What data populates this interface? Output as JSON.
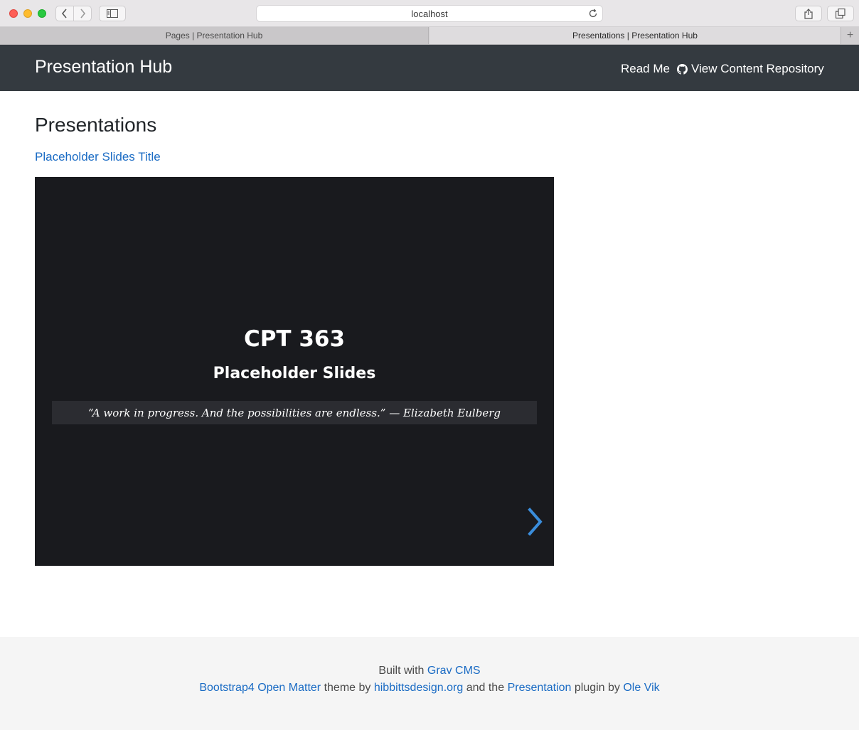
{
  "browser": {
    "url": "localhost",
    "tabs": [
      {
        "label": "Pages | Presentation Hub"
      },
      {
        "label": "Presentations | Presentation Hub"
      }
    ],
    "new_tab_label": "+"
  },
  "header": {
    "brand": "Presentation Hub",
    "nav": {
      "read_me": "Read Me",
      "view_repo": "View Content Repository"
    }
  },
  "main": {
    "title": "Presentations",
    "presentation_link": "Placeholder Slides Title",
    "slide": {
      "title": "CPT 363",
      "subtitle": "Placeholder Slides",
      "quote": "“A work in progress. And the possibilities are endless.” — Elizabeth Eulberg",
      "accent_color": "#3a8ddb"
    }
  },
  "footer": {
    "built_with": "Built with",
    "grav_link": "Grav CMS",
    "theme_link": "Bootstrap4 Open Matter",
    "theme_by": "theme by",
    "design_link": "hibbittsdesign.org",
    "and_the": "and the",
    "plugin_link": "Presentation",
    "plugin_by": "plugin by",
    "author_link": "Ole Vik"
  },
  "colors": {
    "header_bg": "#343a40",
    "link": "#1a6bc4",
    "slide_bg": "#191a1e",
    "footer_bg": "#f5f5f5"
  }
}
